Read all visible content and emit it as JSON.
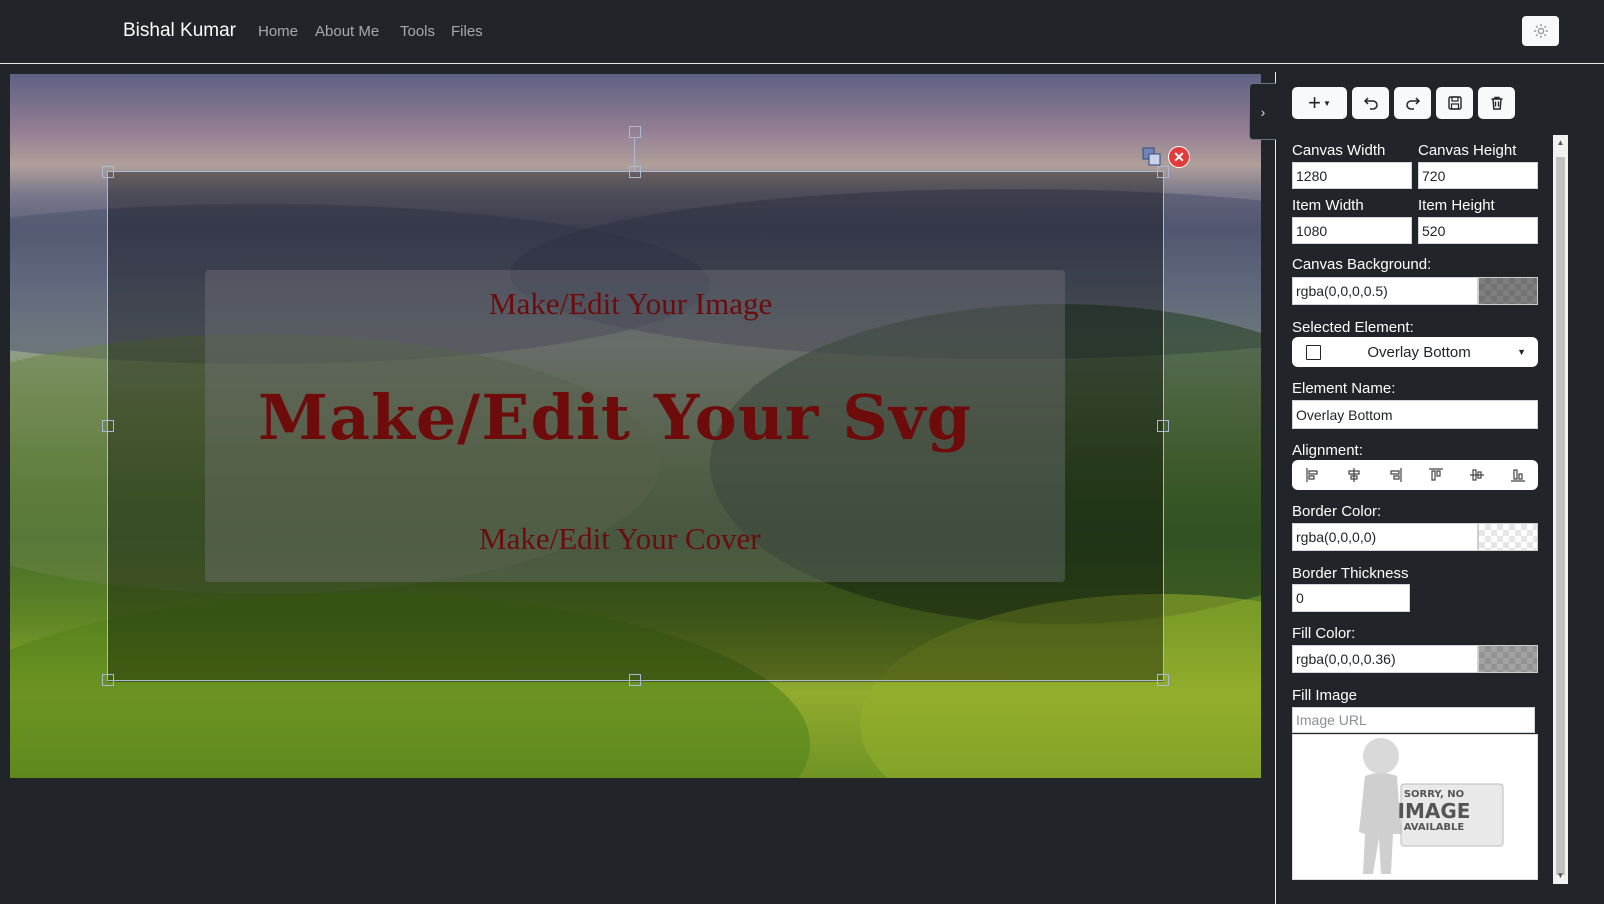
{
  "navbar": {
    "brand": "Bishal Kumar",
    "links": [
      "Home",
      "About Me",
      "Tools",
      "Files"
    ],
    "theme_icon": "gear-icon"
  },
  "canvas": {
    "subtitle_top": "Make/Edit Your Image",
    "title": "Make/Edit Your Svg",
    "subtitle_bottom": "Make/Edit Your Cover",
    "text_color": "#6b0d0d"
  },
  "toolbar": {
    "buttons": [
      "add-icon",
      "undo-icon",
      "redo-icon",
      "save-icon",
      "delete-icon"
    ]
  },
  "panel": {
    "canvas_width_label": "Canvas Width",
    "canvas_width": "1280",
    "canvas_height_label": "Canvas Height",
    "canvas_height": "720",
    "item_width_label": "Item Width",
    "item_width": "1080",
    "item_height_label": "Item Height",
    "item_height": "520",
    "canvas_bg_label": "Canvas Background:",
    "canvas_bg": "rgba(0,0,0,0.5)",
    "selected_element_label": "Selected Element:",
    "selected_element": "Overlay Bottom",
    "element_name_label": "Element Name:",
    "element_name": "Overlay Bottom",
    "alignment_label": "Alignment:",
    "border_color_label": "Border Color:",
    "border_color": "rgba(0,0,0,0)",
    "border_thickness_label": "Border Thickness",
    "border_thickness": "0",
    "fill_color_label": "Fill Color:",
    "fill_color": "rgba(0,0,0,0.36)",
    "fill_image_label": "Fill Image",
    "fill_image_placeholder": "Image URL",
    "no_image_line1": "SORRY, NO",
    "no_image_line2": "IMAGE",
    "no_image_line3": "AVAILABLE"
  }
}
